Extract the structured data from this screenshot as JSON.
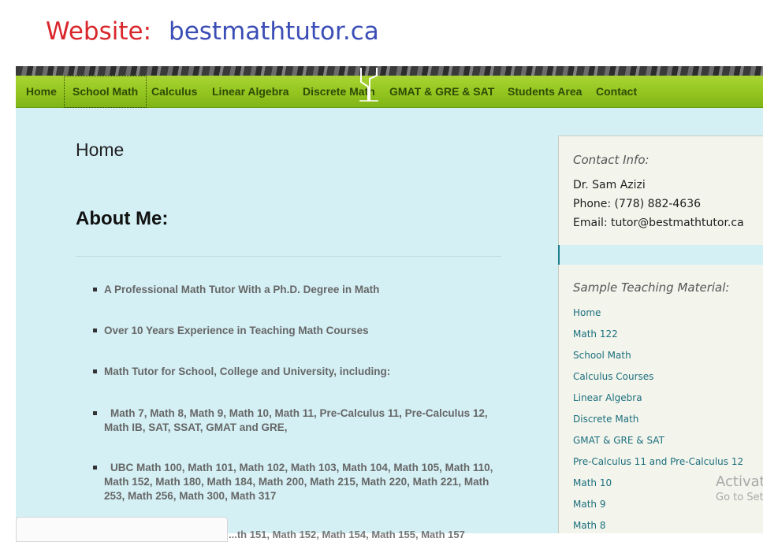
{
  "caption": {
    "label": "Website:",
    "url": "bestmathtutor.ca"
  },
  "nav": {
    "items": [
      {
        "label": "Home"
      },
      {
        "label": "School Math",
        "active": true
      },
      {
        "label": "Calculus"
      },
      {
        "label": "Linear Algebra"
      },
      {
        "label": "Discrete Math"
      },
      {
        "label": "GMAT & GRE & SAT"
      },
      {
        "label": "Students Area"
      },
      {
        "label": "Contact"
      }
    ]
  },
  "main": {
    "page_title": "Home",
    "about_heading": "About Me:",
    "bullets": [
      "A Professional Math Tutor With a Ph.D. Degree in Math",
      "Over 10 Years Experience in Teaching Math Courses",
      "Math Tutor for School, College and University,  including:",
      "Math 7, Math 8, Math 9, Math 10, Math 11, Pre-Calculus 11, Pre-Calculus 12, Math IB, SAT, SSAT, GMAT and GRE,",
      "UBC Math 100, Math 101, Math 102, Math 103, Math 104, Math 105, Math 110, Math 152, Math 180, Math 184, Math 200, Math 215, Math 220, Math 221, Math 253, Math 256, Math 300, Math 317"
    ],
    "clipped_line": "...th 151, Math 152, Math 154, Math 155, Math 157"
  },
  "sidebar": {
    "contact_heading": "Contact Info:",
    "contact_name": "Dr. Sam Azizi",
    "contact_phone": "Phone: (778) 882-4636",
    "contact_email": "Email: tutor@bestmathtutor.ca",
    "material_heading": "Sample Teaching Material:",
    "links": [
      "Home",
      "Math 122",
      "School Math",
      "Calculus Courses",
      "Linear Algebra",
      "Discrete Math",
      "GMAT & GRE & SAT",
      "Pre-Calculus 11 and Pre-Calculus 12",
      "Math 10",
      "Math 9",
      "Math 8"
    ]
  },
  "watermark": {
    "line1": "Activat",
    "line2": "Go to Set"
  },
  "colors": {
    "nav_green": "#93c51f",
    "content_bg": "#d4f0f5",
    "sidebar_bg": "#f3f4ec",
    "link": "#1b6f7d",
    "caption_label": "#d9262b",
    "caption_url": "#3b4db6"
  }
}
